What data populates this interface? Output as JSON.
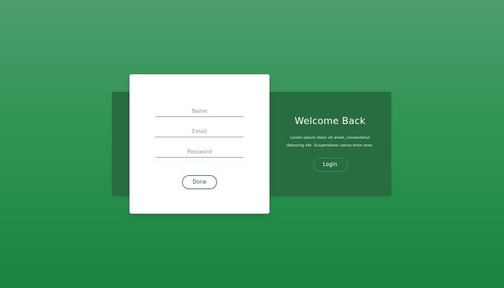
{
  "form": {
    "name_placeholder": "Name",
    "email_placeholder": "Email",
    "password_placeholder": "Password",
    "done_label": "Done"
  },
  "welcome": {
    "title": "Welcome Back",
    "text": "Lorem ipsum dolor sit amet, consectetur dipiscing elit. Suspendisse varius enim eros.",
    "login_label": "Login"
  },
  "colors": {
    "background_top": "#4c9e6c",
    "background_bottom": "#198540",
    "panel": "#276d3f",
    "card": "#ffffff"
  }
}
